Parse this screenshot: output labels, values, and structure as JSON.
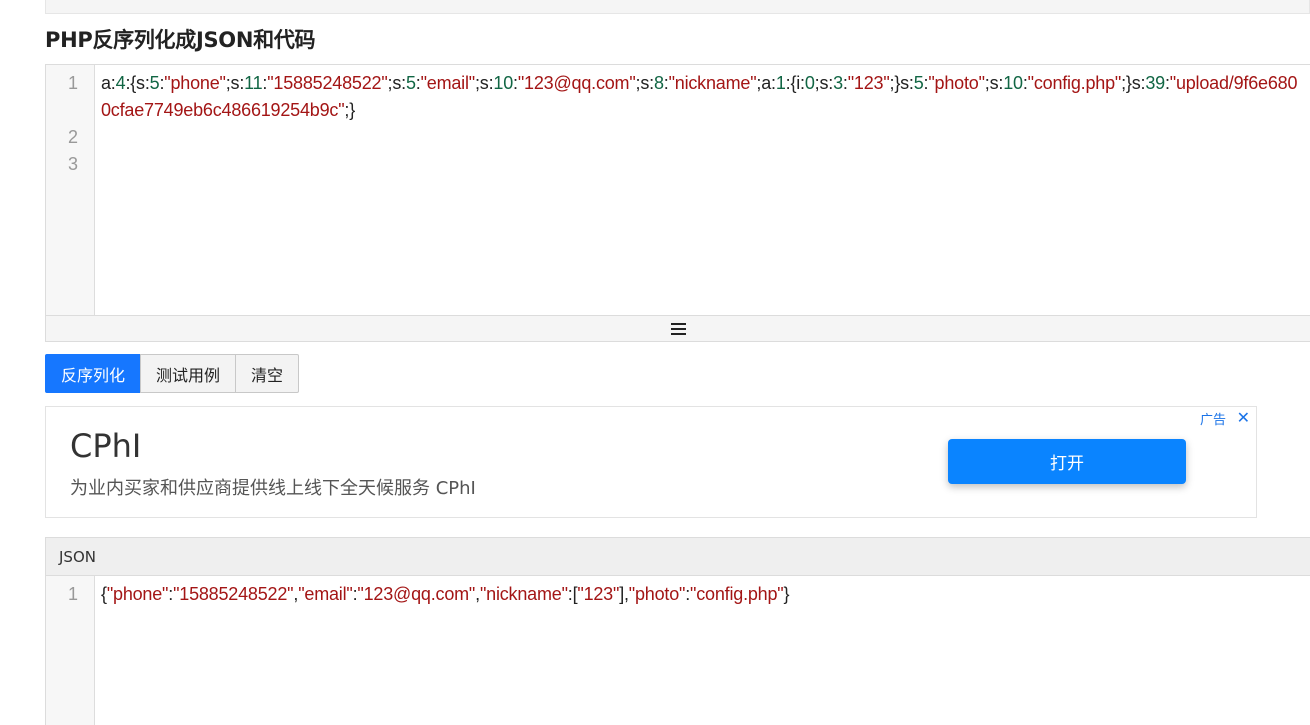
{
  "page": {
    "title": "PHP反序列化成JSON和代码"
  },
  "input_editor": {
    "line_numbers": [
      "1",
      "2",
      "3"
    ],
    "tokens": [
      {
        "t": "plain",
        "v": "a:"
      },
      {
        "t": "num",
        "v": "4"
      },
      {
        "t": "plain",
        "v": ":{s:"
      },
      {
        "t": "num",
        "v": "5"
      },
      {
        "t": "plain",
        "v": ":"
      },
      {
        "t": "str",
        "v": "\"phone\""
      },
      {
        "t": "plain",
        "v": ";s:"
      },
      {
        "t": "num",
        "v": "11"
      },
      {
        "t": "plain",
        "v": ":"
      },
      {
        "t": "str",
        "v": "\"15885248522\""
      },
      {
        "t": "plain",
        "v": ";s:"
      },
      {
        "t": "num",
        "v": "5"
      },
      {
        "t": "plain",
        "v": ":"
      },
      {
        "t": "str",
        "v": "\"email\""
      },
      {
        "t": "plain",
        "v": ";s:"
      },
      {
        "t": "num",
        "v": "10"
      },
      {
        "t": "plain",
        "v": ":"
      },
      {
        "t": "str",
        "v": "\"123@qq.com\""
      },
      {
        "t": "plain",
        "v": ";s:"
      },
      {
        "t": "num",
        "v": "8"
      },
      {
        "t": "plain",
        "v": ":"
      },
      {
        "t": "str",
        "v": "\"nickname\""
      },
      {
        "t": "plain",
        "v": ";a:"
      },
      {
        "t": "num",
        "v": "1"
      },
      {
        "t": "plain",
        "v": ":{i:"
      },
      {
        "t": "num",
        "v": "0"
      },
      {
        "t": "plain",
        "v": ";s:"
      },
      {
        "t": "num",
        "v": "3"
      },
      {
        "t": "plain",
        "v": ":"
      },
      {
        "t": "str",
        "v": "\"123\""
      },
      {
        "t": "plain",
        "v": ";}s:"
      },
      {
        "t": "num",
        "v": "5"
      },
      {
        "t": "plain",
        "v": ":"
      },
      {
        "t": "str",
        "v": "\"photo\""
      },
      {
        "t": "plain",
        "v": ";s:"
      },
      {
        "t": "num",
        "v": "10"
      },
      {
        "t": "plain",
        "v": ":"
      },
      {
        "t": "str",
        "v": "\"config.php\""
      },
      {
        "t": "plain",
        "v": ";}s:"
      },
      {
        "t": "num",
        "v": "39"
      },
      {
        "t": "plain",
        "v": ":"
      },
      {
        "t": "str",
        "v": "\"upload/9f6e6800cfae7749eb6c486619254b9c\""
      },
      {
        "t": "plain",
        "v": ";}"
      }
    ]
  },
  "resize_handle": {
    "icon": "hamburger-icon"
  },
  "buttons": {
    "deserialize": "反序列化",
    "test_case": "测试用例",
    "clear": "清空"
  },
  "ad": {
    "title": "CPhI",
    "description": "为业内买家和供应商提供线上线下全天候服务 CPhI",
    "label": "广告",
    "close": "✕",
    "open_button": "打开"
  },
  "json_panel": {
    "header": "JSON",
    "line_numbers": [
      "1"
    ],
    "tokens": [
      {
        "t": "plain",
        "v": "{"
      },
      {
        "t": "str",
        "v": "\"phone\""
      },
      {
        "t": "plain",
        "v": ":"
      },
      {
        "t": "str",
        "v": "\"15885248522\""
      },
      {
        "t": "plain",
        "v": ","
      },
      {
        "t": "str",
        "v": "\"email\""
      },
      {
        "t": "plain",
        "v": ":"
      },
      {
        "t": "str",
        "v": "\"123@qq.com\""
      },
      {
        "t": "plain",
        "v": ","
      },
      {
        "t": "str",
        "v": "\"nickname\""
      },
      {
        "t": "plain",
        "v": ":["
      },
      {
        "t": "str",
        "v": "\"123\""
      },
      {
        "t": "plain",
        "v": "],"
      },
      {
        "t": "str",
        "v": "\"photo\""
      },
      {
        "t": "plain",
        "v": ":"
      },
      {
        "t": "str",
        "v": "\"config.php\""
      },
      {
        "t": "plain",
        "v": "}"
      }
    ]
  },
  "colors": {
    "primary": "#1677ff",
    "string": "#a31515",
    "number": "#116644"
  }
}
